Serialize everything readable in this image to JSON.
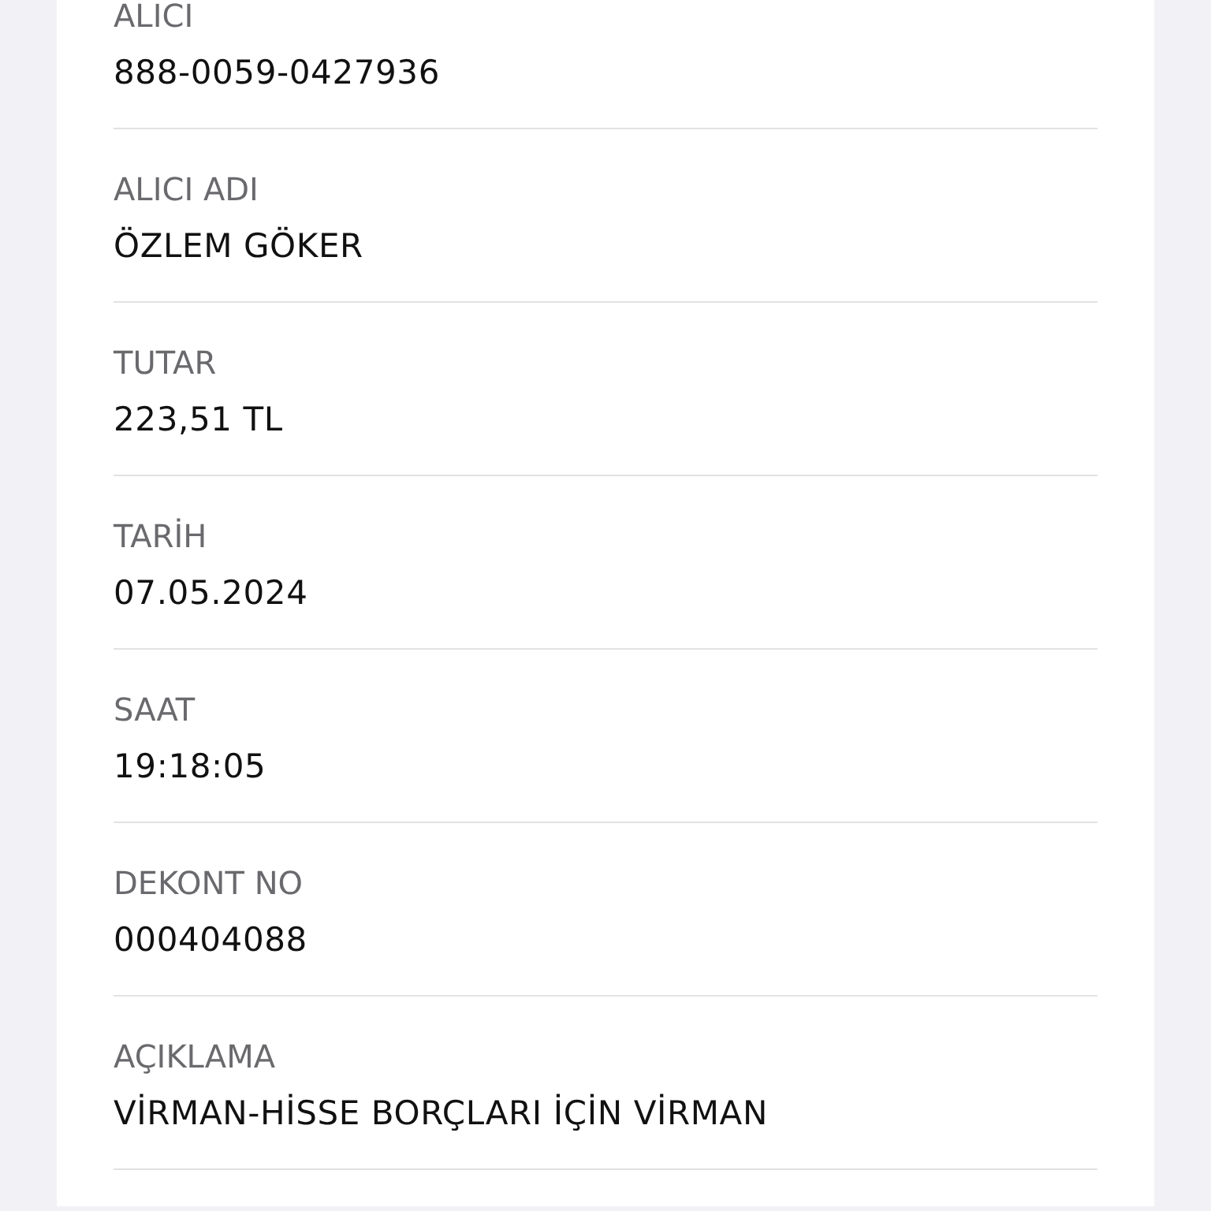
{
  "fields": [
    {
      "label": "ALICI",
      "value": "888-0059-0427936"
    },
    {
      "label": "ALICI ADI",
      "value": "ÖZLEM GÖKER"
    },
    {
      "label": "TUTAR",
      "value": "223,51 TL"
    },
    {
      "label": "TARİH",
      "value": "07.05.2024"
    },
    {
      "label": "SAAT",
      "value": "19:18:05"
    },
    {
      "label": "DEKONT NO",
      "value": "000404088"
    },
    {
      "label": "AÇIKLAMA",
      "value": "VİRMAN-HİSSE BORÇLARI İÇİN VİRMAN"
    }
  ]
}
